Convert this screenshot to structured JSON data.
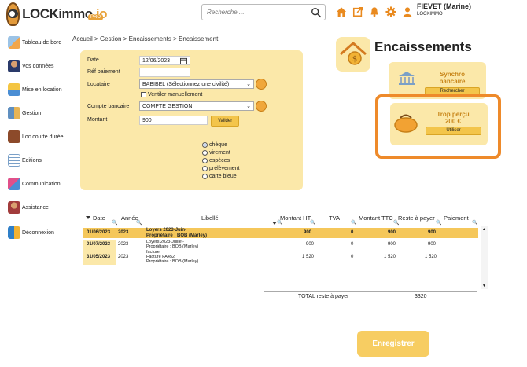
{
  "header": {
    "logo_text": "LOCKimmo",
    "logo_suffix": ".io",
    "logo_badge": "PRO",
    "search_placeholder": "Recherche ...",
    "user_name": "FIEVET (Marine)",
    "user_company": "LOCKIMMO"
  },
  "sidebar": {
    "items": [
      {
        "label": "Tableau de bord",
        "icon": "dashboard-icon"
      },
      {
        "label": "Vos données",
        "icon": "user-data-icon"
      },
      {
        "label": "Mise en location",
        "icon": "rental-icon"
      },
      {
        "label": "Gestion",
        "icon": "management-icon"
      },
      {
        "label": "Loc courte durée",
        "icon": "short-stay-icon"
      },
      {
        "label": "Editions",
        "icon": "editions-icon"
      },
      {
        "label": "Communication",
        "icon": "communication-icon"
      },
      {
        "label": "Assistance",
        "icon": "assistance-icon"
      },
      {
        "label": "Déconnexion",
        "icon": "logout-icon"
      }
    ]
  },
  "breadcrumb": {
    "accueil": "Accueil",
    "gestion": "Gestion",
    "encaissements": "Encaissements",
    "current": "Encaissement",
    "sep": ">"
  },
  "form": {
    "date_label": "Date",
    "date_value": "12/06/2023",
    "ref_label": "Réf paiement",
    "ref_value": "",
    "locataire_label": "Locataire",
    "locataire_value": "BABIBEL (Sélectionnez une civilité)",
    "ventiler_label": "Ventiler manuellement",
    "compte_label": "Compte bancaire",
    "compte_value": "COMPTE GESTION",
    "montant_label": "Montant",
    "montant_value": "900",
    "valider_label": "Valider",
    "payment_modes": [
      "chèque",
      "virement",
      "espèces",
      "prélèvement",
      "carte bleue"
    ],
    "payment_selected": 0
  },
  "title": "Encaissements",
  "sync_card": {
    "title_line1": "Synchro",
    "title_line2": "bancaire",
    "button": "Rechercher"
  },
  "overpay_card": {
    "title": "Trop perçu",
    "amount": "200 €",
    "button": "Utiliser"
  },
  "table": {
    "headers": [
      "Date",
      "Année",
      "Libellé",
      "Montant HT",
      "TVA",
      "Montant TTC",
      "Reste à payer",
      "Paiement"
    ],
    "rows": [
      {
        "date": "01/06/2023",
        "annee": "2023",
        "libelle1": "Loyers 2023-Juin-",
        "libelle2": "Propriétaire : BOB (Marley)",
        "libelle3": "",
        "ht": "900",
        "tva": "0",
        "ttc": "900",
        "reste": "900"
      },
      {
        "date": "01/07/2023",
        "annee": "2023",
        "libelle1": "Loyers 2023-Juillet-",
        "libelle2": "Propriétaire : BOB (Marley)",
        "libelle3": "",
        "ht": "900",
        "tva": "0",
        "ttc": "900",
        "reste": "900"
      },
      {
        "date": "31/05/2023",
        "annee": "2023",
        "libelle1": "facture",
        "libelle2": "Facture FA452",
        "libelle3": "Propriétaire : BOB (Marley)",
        "ht": "1 520",
        "tva": "0",
        "ttc": "1 520",
        "reste": "1 520"
      }
    ],
    "total_label": "TOTAL reste à payer",
    "total_value": "3320"
  },
  "save_button": "Enregistrer",
  "colors": {
    "accent": "#f3c54b",
    "panel": "#fbe8a9",
    "highlight": "#ee8a2a"
  }
}
